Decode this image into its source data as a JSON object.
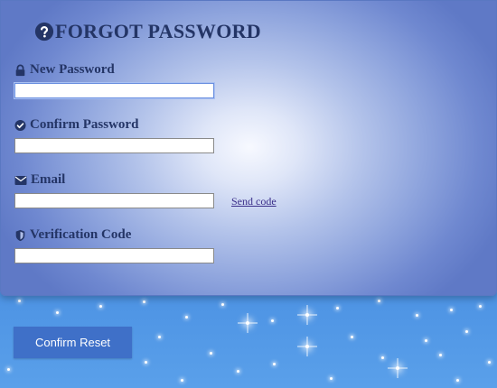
{
  "form": {
    "title": "FORGOT PASSWORD",
    "title_icon": "question-circle-icon",
    "fields": [
      {
        "label": "New Password",
        "icon": "lock-icon",
        "value": "",
        "placeholder": ""
      },
      {
        "label": "Confirm Password",
        "icon": "check-circle-icon",
        "value": "",
        "placeholder": ""
      },
      {
        "label": "Email",
        "icon": "envelope-icon",
        "value": "",
        "placeholder": ""
      },
      {
        "label": "Verification Code",
        "icon": "shield-icon",
        "value": "",
        "placeholder": ""
      }
    ],
    "send_code_label": "Send code",
    "submit_label": "Confirm Reset"
  },
  "colors": {
    "heading": "#243566",
    "button_bg": "#3f70c8",
    "link": "#3b2f8a"
  }
}
